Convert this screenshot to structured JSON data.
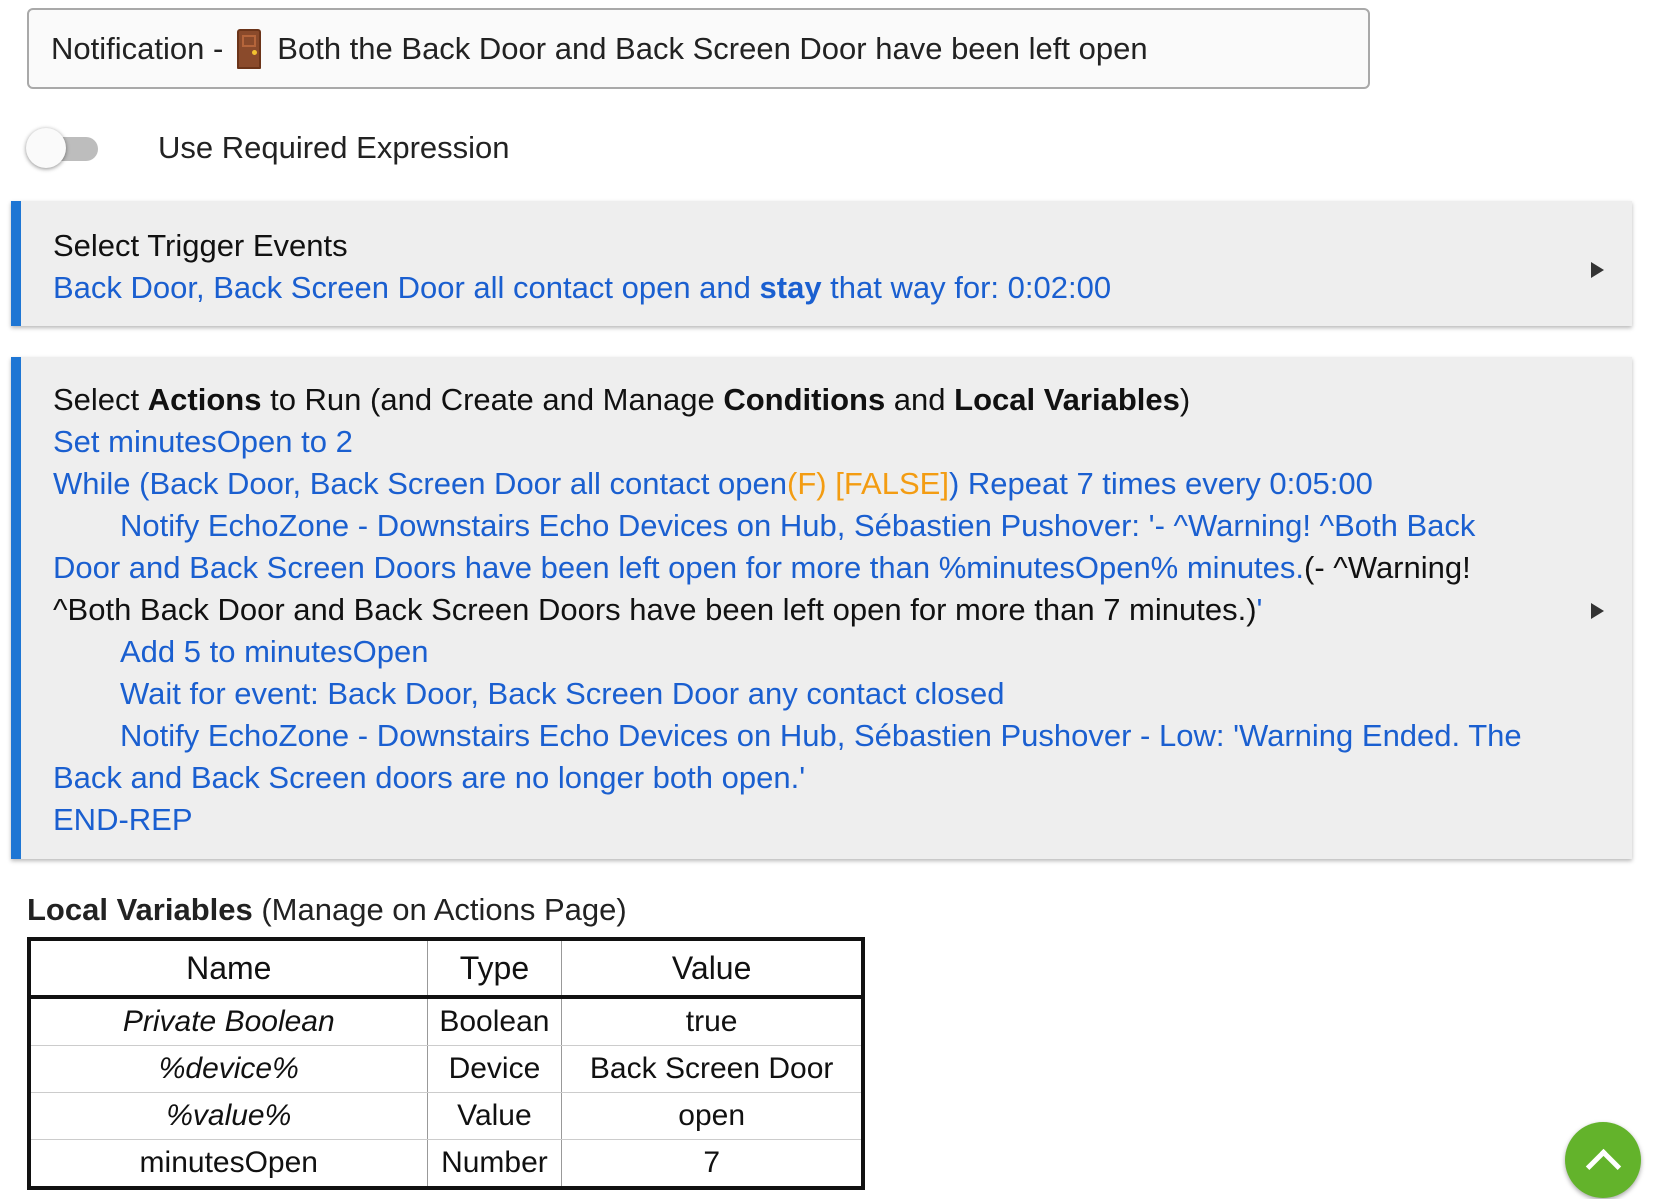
{
  "rule_name": {
    "prefix": "Notification -",
    "emoji": "door-emoji",
    "text": "Both the Back Door and Back Screen Door have been left open"
  },
  "required_expression": {
    "label": "Use Required Expression",
    "enabled": false
  },
  "trigger_panel": {
    "title": "Select Trigger Events",
    "summary_part1": "Back Door, Back Screen Door all contact open and ",
    "summary_bold": "stay",
    "summary_part2": " that way for: 0:02:00"
  },
  "actions_panel": {
    "title_part1": "Select ",
    "title_bold1": "Actions",
    "title_part2": " to Run (and Create and Manage ",
    "title_bold2": "Conditions",
    "title_part3": " and ",
    "title_bold3": "Local Variables",
    "title_part4": ")",
    "set_action": "Set minutesOpen to 2",
    "while_part1": "While (Back Door, Back Screen Door all contact open",
    "while_flag": "(F) [FALSE]",
    "while_part2": ") Repeat 7 times every 0:05:00",
    "notify1_blue": "Notify EchoZone - Downstairs Echo Devices on Hub, Sébastien Pushover: '- ^Warning! ^Both Back Door and Back Screen Doors have been left open for more than %minutesOpen% minutes.",
    "notify1_black": "(- ^Warning! ^Both Back Door and Back Screen Doors have been left open for more than 7 minutes.)",
    "notify1_end": "'",
    "add_action": "Add 5 to minutesOpen",
    "wait_action": "Wait for event: Back Door, Back Screen Door any contact closed",
    "notify2": "Notify EchoZone - Downstairs Echo Devices on Hub, Sébastien Pushover - Low: 'Warning Ended. The Back and Back Screen doors are no longer both open.'",
    "end_rep": "END-REP"
  },
  "local_variables": {
    "title_bold": "Local Variables",
    "title_rest": " (Manage on Actions Page)",
    "columns": [
      "Name",
      "Type",
      "Value"
    ],
    "rows": [
      {
        "name": "Private Boolean",
        "type": "Boolean",
        "value": "true"
      },
      {
        "name": "%device%",
        "type": "Device",
        "value": "Back Screen Door"
      },
      {
        "name": "%value%",
        "type": "Value",
        "value": "open"
      },
      {
        "name": "minutesOpen",
        "type": "Number",
        "value": "7"
      }
    ]
  },
  "colors": {
    "accent_blue": "#1e76d4",
    "link_blue": "#1a5fd0",
    "false_orange": "#f39c12",
    "fab_green": "#63b32b"
  },
  "scroll_top_icon": "chevron-up-icon"
}
